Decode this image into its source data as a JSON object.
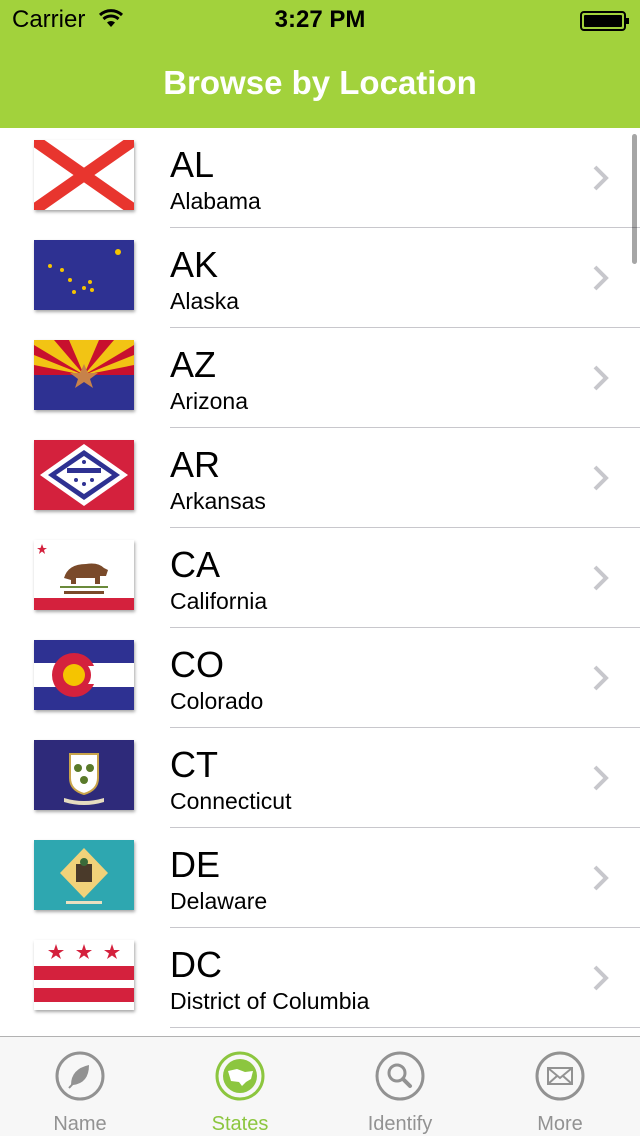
{
  "status_bar": {
    "carrier": "Carrier",
    "time": "3:27 PM"
  },
  "nav": {
    "title": "Browse by Location"
  },
  "states": [
    {
      "abbr": "AL",
      "name": "Alabama",
      "flag": "alabama-flag"
    },
    {
      "abbr": "AK",
      "name": "Alaska",
      "flag": "alaska-flag"
    },
    {
      "abbr": "AZ",
      "name": "Arizona",
      "flag": "arizona-flag"
    },
    {
      "abbr": "AR",
      "name": "Arkansas",
      "flag": "arkansas-flag"
    },
    {
      "abbr": "CA",
      "name": "California",
      "flag": "california-flag"
    },
    {
      "abbr": "CO",
      "name": "Colorado",
      "flag": "colorado-flag"
    },
    {
      "abbr": "CT",
      "name": "Connecticut",
      "flag": "connecticut-flag"
    },
    {
      "abbr": "DE",
      "name": "Delaware",
      "flag": "delaware-flag"
    },
    {
      "abbr": "DC",
      "name": "District of Columbia",
      "flag": "district-of-columbia-flag"
    }
  ],
  "tabs": [
    {
      "label": "Name",
      "icon": "leaf-icon",
      "active": false
    },
    {
      "label": "States",
      "icon": "map-icon",
      "active": true
    },
    {
      "label": "Identify",
      "icon": "magnifier-icon",
      "active": false
    },
    {
      "label": "More",
      "icon": "envelope-icon",
      "active": false
    }
  ],
  "colors": {
    "accent": "#a2d23c",
    "tab_active": "#8cc63f",
    "tab_inactive": "#929292",
    "separator": "#c8c7cc"
  }
}
